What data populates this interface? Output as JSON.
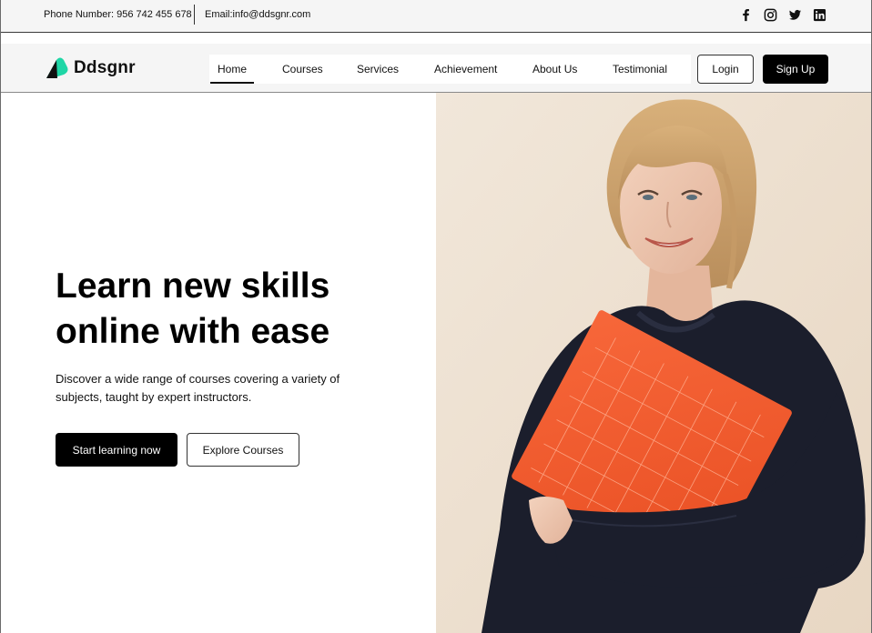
{
  "topbar": {
    "phone": "Phone Number: 956 742 455 678",
    "email": "Email:info@ddsgnr.com",
    "socials": [
      "facebook-icon",
      "instagram-icon",
      "twitter-icon",
      "linkedin-icon"
    ]
  },
  "brand": {
    "name": "Ddsgnr",
    "accent": "#1fd6a6"
  },
  "nav": {
    "items": [
      {
        "label": "Home",
        "active": true
      },
      {
        "label": "Courses"
      },
      {
        "label": "Services"
      },
      {
        "label": "Achievement"
      },
      {
        "label": "About Us"
      },
      {
        "label": "Testimonial"
      }
    ],
    "login_label": "Login",
    "signup_label": "Sign Up"
  },
  "hero": {
    "title_line1": "Learn new skills",
    "title_line2": "online with ease",
    "subtitle_line1": "Discover a wide range of courses covering a variety of",
    "subtitle_line2": "subjects, taught by expert instructors.",
    "primary_cta": "Start learning now",
    "secondary_cta": "Explore Courses"
  },
  "colors": {
    "folder": "#f2582b",
    "sweater": "#1b1e2c",
    "backdrop": "#efe3d4"
  }
}
